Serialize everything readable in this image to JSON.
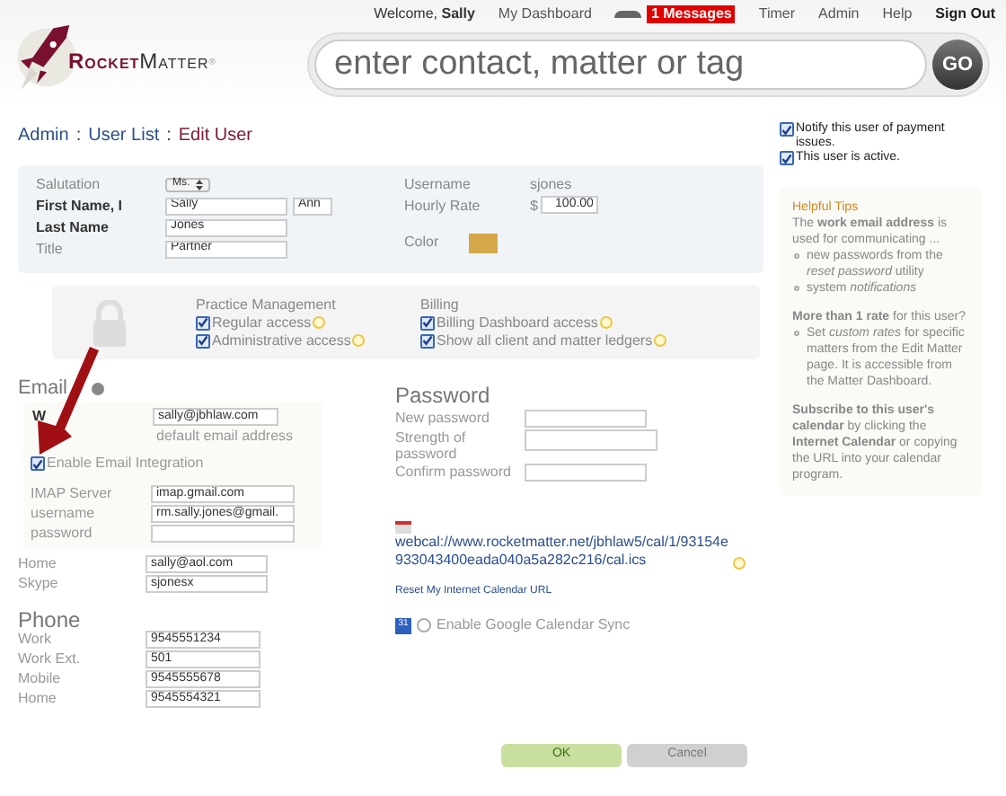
{
  "header": {
    "welcome": {
      "prefix": "Welcome,",
      "name": "Sally"
    },
    "links": [
      {
        "kind": "link",
        "label": "My Dashboard"
      },
      {
        "kind": "messages",
        "label": "1 Messages"
      },
      {
        "kind": "link",
        "label": "Timer"
      },
      {
        "kind": "link",
        "label": "Admin"
      },
      {
        "kind": "link",
        "label": "Help"
      },
      {
        "kind": "strong",
        "label": "Sign Out"
      }
    ],
    "logo": {
      "first": "Rocket",
      "second": "Matter",
      "mark": "®"
    },
    "search": {
      "placeholder": "enter contact, matter or tag",
      "button": "GO"
    }
  },
  "breadcrumb": {
    "separator": ":",
    "items": [
      {
        "label": "Admin",
        "current": false
      },
      {
        "label": "User List",
        "current": false
      },
      {
        "label": "Edit User",
        "current": true
      }
    ]
  },
  "account_flags": [
    {
      "label": "Notify this user of payment issues.",
      "checked": true
    },
    {
      "label": "This user is active.",
      "checked": true
    }
  ],
  "profile": {
    "salutation": {
      "label": "Salutation",
      "value": "Ms."
    },
    "first_name": {
      "label": "First Name, I",
      "value": "Sally",
      "middle": "Ann"
    },
    "last_name": {
      "label": "Last Name",
      "value": "Jones"
    },
    "title": {
      "label": "Title",
      "value": "Partner"
    },
    "username": {
      "label": "Username",
      "value": "sjones"
    },
    "hourly_rate": {
      "label": "Hourly Rate",
      "currency": "$",
      "value": "100.00"
    },
    "color": {
      "label": "Color",
      "color": "#d4a84a"
    }
  },
  "permissions": [
    {
      "title": "Practice Management",
      "items": [
        {
          "label": "Regular access",
          "checked": true
        },
        {
          "label": "Administrative access",
          "checked": true
        }
      ]
    },
    {
      "title": "Billing",
      "items": [
        {
          "label": "Billing Dashboard access",
          "checked": true
        },
        {
          "label": "Show all client and matter ledgers",
          "checked": true
        }
      ]
    }
  ],
  "email": {
    "title": "Email",
    "work": {
      "label": "W",
      "value": "sally@jbhlaw.com",
      "note": "default email address"
    },
    "integration": {
      "label": "Enable Email Integration",
      "checked": true
    },
    "imap": [
      {
        "label": "IMAP Server",
        "value": "imap.gmail.com"
      },
      {
        "label": "username",
        "value": "rm.sally.jones@gmail."
      },
      {
        "label": "password"
      }
    ],
    "other": [
      {
        "label": "Home",
        "value": "sally@aol.com"
      },
      {
        "label": "Skype",
        "value": "sjonesx"
      }
    ]
  },
  "phone": {
    "title": "Phone",
    "fields": [
      {
        "label": "Work",
        "value": "9545551234"
      },
      {
        "label": "Work Ext.",
        "value": "501"
      },
      {
        "label": "Mobile",
        "value": "9545555678"
      },
      {
        "label": "Home",
        "value": "9545554321"
      }
    ]
  },
  "password": {
    "title": "Password",
    "fields": [
      {
        "label": "New password",
        "kind": "plain"
      },
      {
        "label": "Strength of password",
        "kind": "strength"
      },
      {
        "label": "Confirm password",
        "kind": "plain"
      }
    ]
  },
  "calendar": {
    "url": "webcal://www.rocketmatter.net/jbhlaw5/cal/1/93154e933043400eada040a5a282c216/cal.ics",
    "reset": "Reset My Internet Calendar URL",
    "google_badge": "31",
    "google_sync": {
      "label": "Enable Google Calendar Sync",
      "checked": false
    }
  },
  "tips": {
    "title": "Helpful Tips",
    "blocks": [
      {
        "text": "The **work email address** is used for communicating ...",
        "bullets": [
          "new passwords from the *reset password* utility",
          "system *notifications*"
        ]
      },
      {
        "text": "**More than 1 rate** for this user?",
        "bullets": [
          "Set *custom rates* for specific matters from the Edit Matter page. It is accessible from the Matter Dashboard."
        ]
      },
      {
        "text": "**Subscribe to this user's calendar** by clicking the **Internet Calendar** or copying the URL into your calendar program."
      }
    ]
  },
  "buttons": [
    {
      "label": "OK",
      "kind": "primary"
    },
    {
      "label": "Cancel",
      "kind": "secondary"
    }
  ]
}
